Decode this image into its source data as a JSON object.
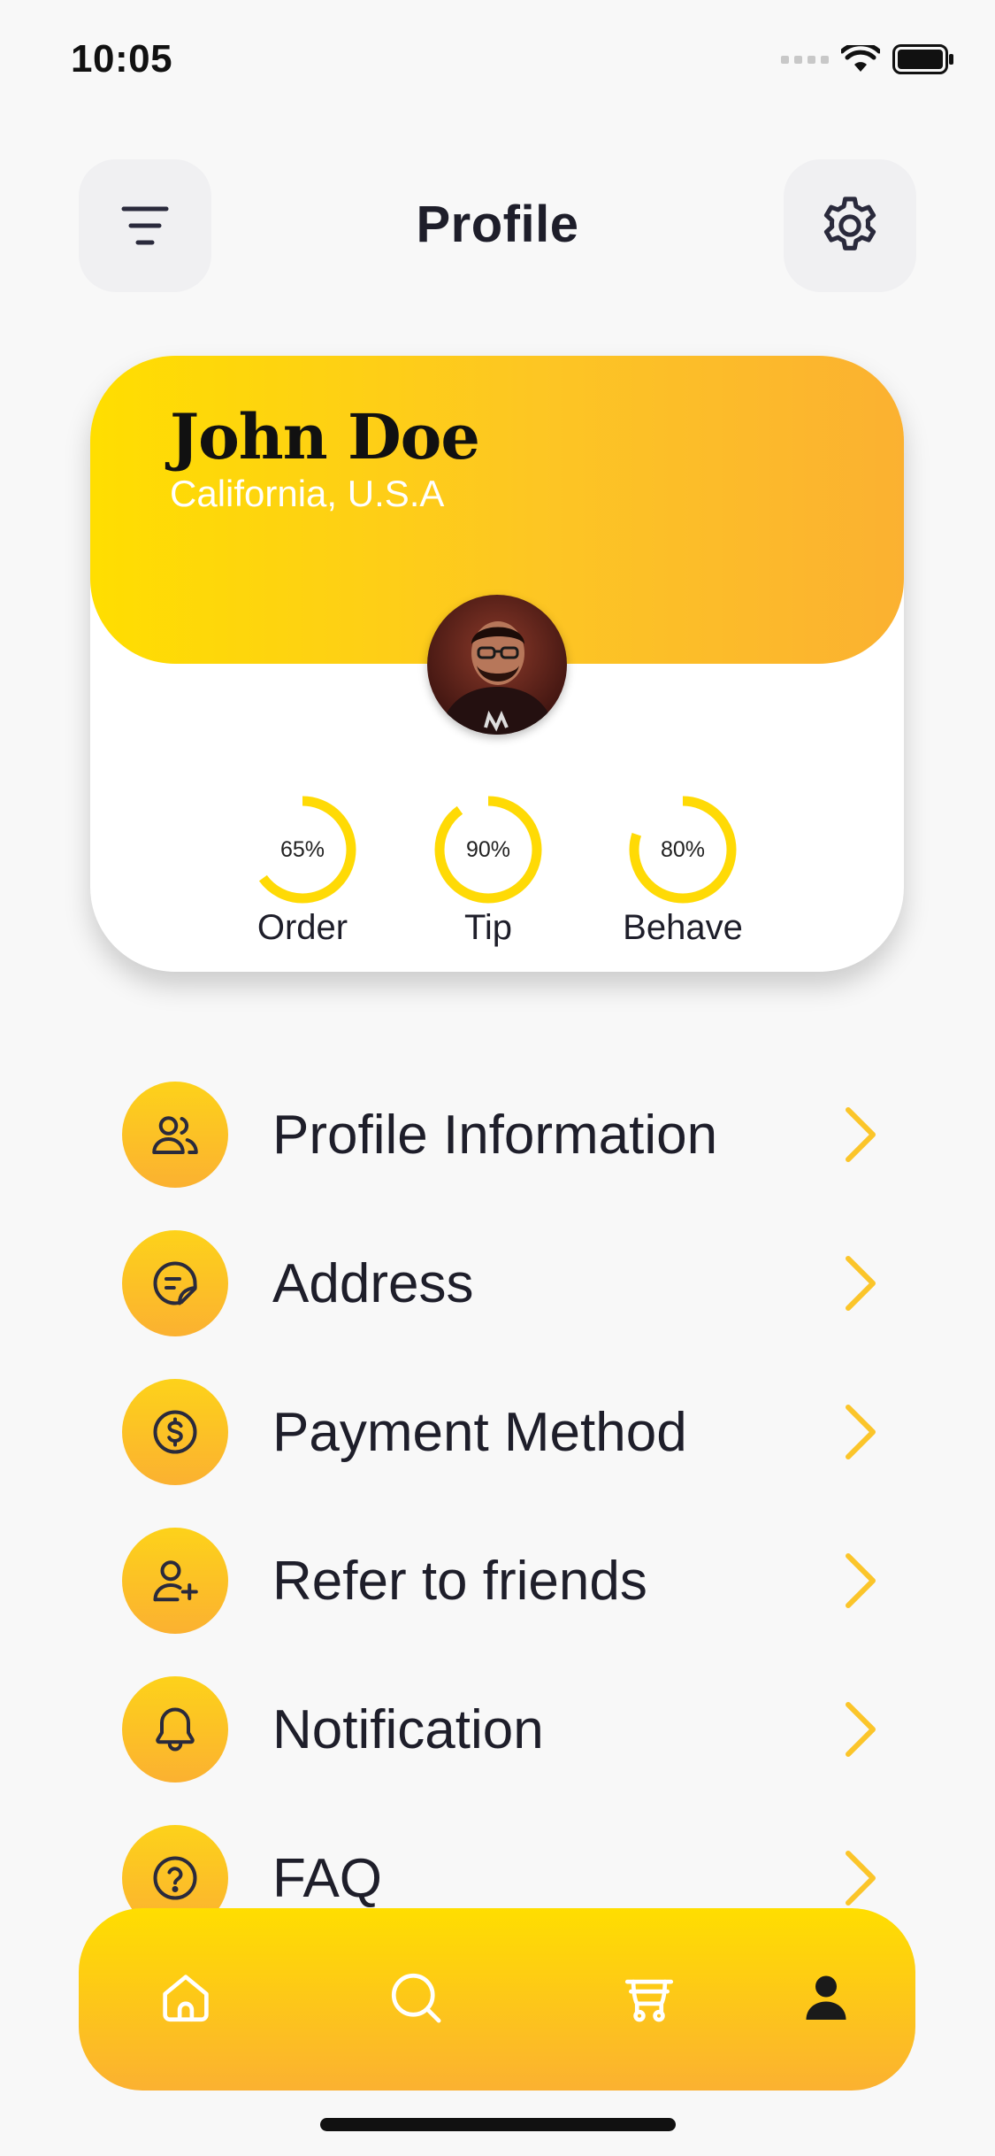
{
  "status_bar": {
    "time": "10:05"
  },
  "header": {
    "title": "Profile"
  },
  "profile": {
    "name": "John Doe",
    "location": "California, U.S.A"
  },
  "stats": [
    {
      "label": "Order",
      "value_text": "65%",
      "fraction": 0.65
    },
    {
      "label": "Tip",
      "value_text": "90%",
      "fraction": 0.9
    },
    {
      "label": "Behave",
      "value_text": "80%",
      "fraction": 0.8
    }
  ],
  "menu": [
    {
      "label": "Profile Information",
      "icon": "users-icon"
    },
    {
      "label": "Address",
      "icon": "note-icon"
    },
    {
      "label": "Payment Method",
      "icon": "dollar-coin-icon"
    },
    {
      "label": "Refer to friends",
      "icon": "user-plus-icon"
    },
    {
      "label": "Notification",
      "icon": "bell-icon"
    },
    {
      "label": "FAQ",
      "icon": "question-icon"
    }
  ],
  "bottom_nav": [
    {
      "icon": "home-icon",
      "active": false
    },
    {
      "icon": "search-icon",
      "active": false
    },
    {
      "icon": "cart-icon",
      "active": false
    },
    {
      "icon": "profile-icon",
      "active": true
    }
  ],
  "colors": {
    "accent_yellow": "#FFDE00",
    "accent_orange": "#FBB131",
    "text_dark": "#1E1E2A",
    "background": "#F8F8F8"
  }
}
